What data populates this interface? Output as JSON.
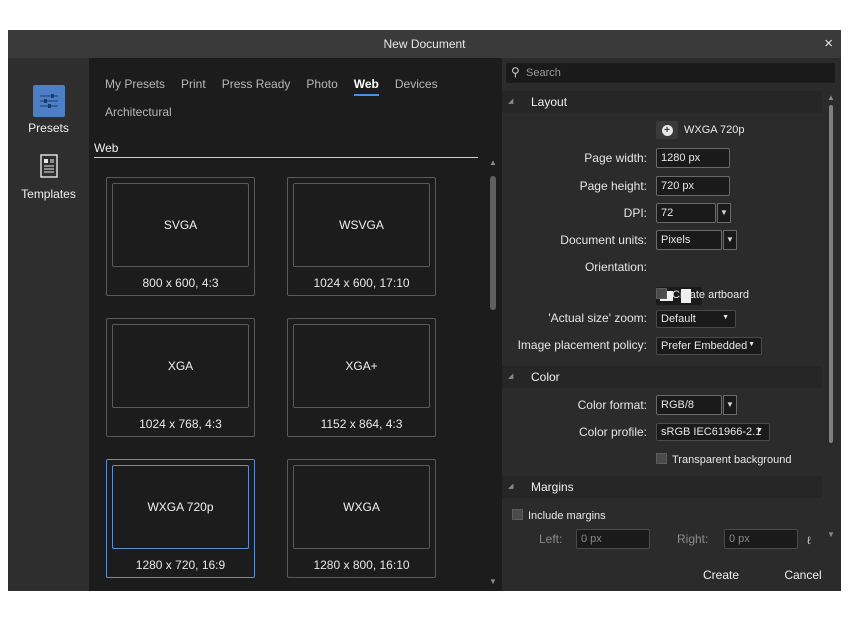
{
  "window": {
    "title": "New Document",
    "close_icon": "×"
  },
  "sidebar": {
    "items": [
      {
        "label": "Presets",
        "icon": "presets-sliders-icon",
        "active": true
      },
      {
        "label": "Templates",
        "icon": "templates-document-icon",
        "active": false
      }
    ]
  },
  "tabs": [
    "My Presets",
    "Print",
    "Press Ready",
    "Photo",
    "Web",
    "Devices",
    "Architectural"
  ],
  "active_tab": "Web",
  "section_title": "Web",
  "presets": [
    {
      "name": "SVGA",
      "caption": "800 x 600, 4:3",
      "selected": false
    },
    {
      "name": "WSVGA",
      "caption": "1024 x 600, 17:10",
      "selected": false
    },
    {
      "name": "XGA",
      "caption": "1024 x 768, 4:3",
      "selected": false
    },
    {
      "name": "XGA+",
      "caption": "1152 x 864, 4:3",
      "selected": false
    },
    {
      "name": "WXGA 720p",
      "caption": "1280 x 720, 16:9",
      "selected": true
    },
    {
      "name": "WXGA",
      "caption": "1280 x 800, 16:10",
      "selected": false
    }
  ],
  "search": {
    "placeholder": "Search",
    "icon": "search-icon"
  },
  "layout": {
    "section": "Layout",
    "preset_name": "WXGA 720p",
    "page_width_label": "Page width:",
    "page_width": "1280 px",
    "page_height_label": "Page height:",
    "page_height": "720 px",
    "dpi_label": "DPI:",
    "dpi": "72",
    "units_label": "Document units:",
    "units": "Pixels",
    "orientation_label": "Orientation:",
    "create_artboard": "Create artboard",
    "zoom_label": "'Actual size' zoom:",
    "zoom": "Default",
    "placement_label": "Image placement policy:",
    "placement": "Prefer Embedded"
  },
  "color": {
    "section": "Color",
    "format_label": "Color format:",
    "format": "RGB/8",
    "profile_label": "Color profile:",
    "profile": "sRGB IEC61966-2.1",
    "transparent_bg": "Transparent background"
  },
  "margins": {
    "section": "Margins",
    "include": "Include margins",
    "left_label": "Left:",
    "left_value": "0 px",
    "right_label": "Right:",
    "right_value": "0 px"
  },
  "footer": {
    "create": "Create",
    "cancel": "Cancel"
  },
  "colors": {
    "accent": "#4c8fe8",
    "panel": "#2e2e2e",
    "content": "#1c1c1c",
    "selected_border": "#5b8fd0"
  }
}
